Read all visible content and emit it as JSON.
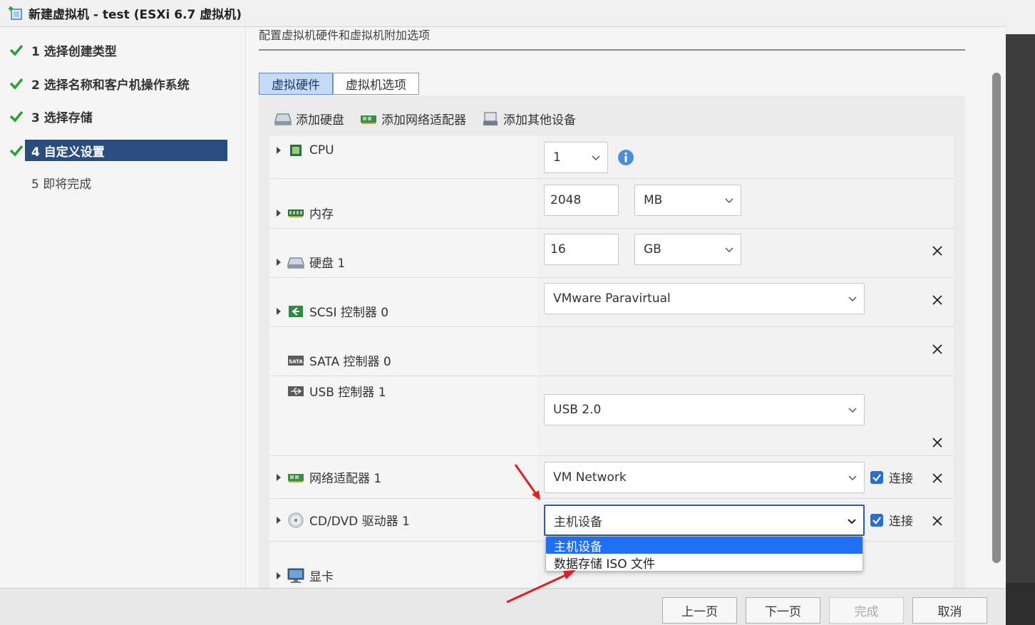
{
  "window": {
    "title": "新建虚拟机 - test (ESXi 6.7 虚拟机)"
  },
  "steps": [
    {
      "label": "1 选择创建类型",
      "state": "done"
    },
    {
      "label": "2 选择名称和客户机操作系统",
      "state": "done"
    },
    {
      "label": "3 选择存储",
      "state": "done"
    },
    {
      "label": "4 自定义设置",
      "state": "active"
    },
    {
      "label": "5 即将完成",
      "state": "pending"
    }
  ],
  "main": {
    "subtitle": "配置虚拟机硬件和虚拟机附加选项",
    "tabs": [
      {
        "label": "虚拟硬件",
        "active": true
      },
      {
        "label": "虚拟机选项",
        "active": false
      }
    ],
    "toolbar": {
      "add_disk": "添加硬盘",
      "add_nic": "添加网络适配器",
      "add_other": "添加其他设备"
    }
  },
  "hardware": {
    "cpu": {
      "label": "CPU",
      "value": "1"
    },
    "memory": {
      "label": "内存",
      "value": "2048",
      "unit": "MB"
    },
    "disk": {
      "label": "硬盘 1",
      "value": "16",
      "unit": "GB"
    },
    "scsi": {
      "label": "SCSI 控制器 0",
      "value": "VMware Paravirtual"
    },
    "sata": {
      "label": "SATA 控制器 0"
    },
    "usb": {
      "label": "USB 控制器 1",
      "value": "USB 2.0"
    },
    "nic": {
      "label": "网络适配器 1",
      "value": "VM Network",
      "connect_label": "连接",
      "connected": true
    },
    "cddvd": {
      "label": "CD/DVD 驱动器 1",
      "value": "主机设备",
      "connect_label": "连接",
      "connected": true
    },
    "video": {
      "label": "显卡"
    }
  },
  "dropdown": {
    "options": [
      {
        "label": "主机设备",
        "selected": true
      },
      {
        "label": "数据存储 ISO 文件",
        "selected": false
      }
    ]
  },
  "footer": {
    "prev": "上一页",
    "next": "下一页",
    "finish": "完成",
    "cancel": "取消"
  },
  "colors": {
    "accent": "#2b4c7e",
    "check": "#2e9e3a",
    "dropdown_selected": "#1e6ff5",
    "annotation_arrow": "#e02020"
  }
}
